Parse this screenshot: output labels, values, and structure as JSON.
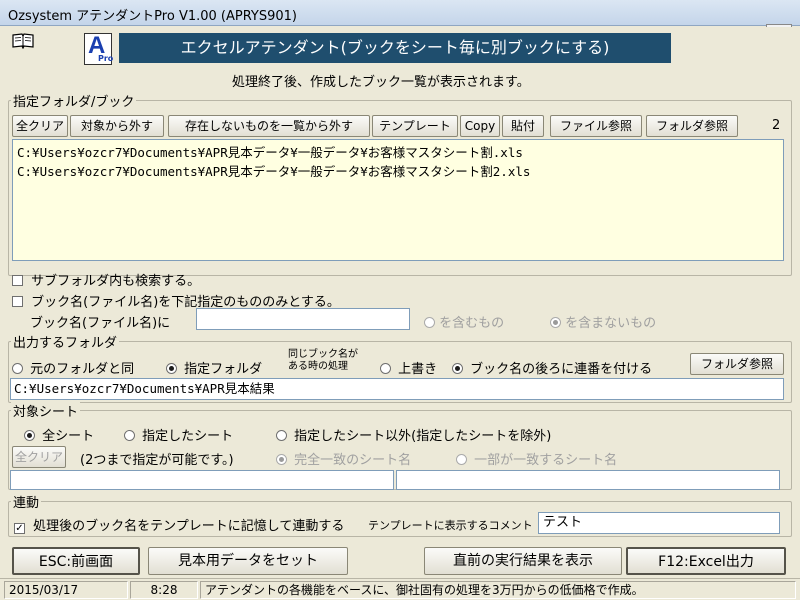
{
  "window": {
    "title": "Ozsystem アテンダントPro V1.00 (APRYS901)",
    "close_glyph": "✕",
    "restore_glyph": "▭"
  },
  "header": {
    "logo_letter": "A",
    "logo_sub": "Pro",
    "banner": "エクセルアテンダント(ブックをシート毎に別ブックにする)",
    "subtitle": "処理終了後、作成したブック一覧が表示されます。"
  },
  "folder_group": {
    "label": "指定フォルダ/ブック",
    "buttons": {
      "clear_all": "全クリア",
      "remove_from_target": "対象から外す",
      "remove_missing": "存在しないものを一覧から外す",
      "template": "テンプレート",
      "copy": "Copy",
      "paste": "貼付",
      "browse_file": "ファイル参照",
      "browse_folder": "フォルダ参照"
    },
    "count": "2",
    "files": [
      "C:¥Users¥ozcr7¥Documents¥APR見本データ¥一般データ¥お客様マスタシート割.xls",
      "C:¥Users¥ozcr7¥Documents¥APR見本データ¥一般データ¥お客様マスタシート割2.xls"
    ],
    "subfolder_label": "サブフォルダ内も検索する。",
    "bookname_only_label": "ブック名(ファイル名)を下記指定のもののみとする。",
    "bookname_field_label": "ブック名(ファイル名)に",
    "bookname_value": "",
    "include_label": "を含むもの",
    "exclude_label": "を含まないもの"
  },
  "output_group": {
    "label": "出力するフォルダ",
    "same_folder_label": "元のフォルダと同",
    "specified_folder_label": "指定フォルダ",
    "same_name_line1": "同じブック名が",
    "same_name_line2": "ある時の処理",
    "overwrite_label": "上書き",
    "append_number_label": "ブック名の後ろに連番を付ける",
    "browse_folder": "フォルダ参照",
    "path": "C:¥Users¥ozcr7¥Documents¥APR見本結果"
  },
  "sheet_group": {
    "label": "対象シート",
    "all_sheets": "全シート",
    "specified_sheets": "指定したシート",
    "except_specified": "指定したシート以外(指定したシートを除外)",
    "clear_all": "全クリア",
    "hint": "(2つまで指定が可能です。)",
    "exact_match": "完全一致のシート名",
    "partial_match": "一部が一致するシート名",
    "field1_value": "",
    "field2_value": ""
  },
  "link_group": {
    "label": "連動",
    "remember_label": "処理後のブック名をテンプレートに記憶して連動する",
    "comment_label": "テンプレートに表示するコメント",
    "comment_value": "テスト"
  },
  "footer_buttons": {
    "esc": "ESC:前画面",
    "sample": "見本用データをセット",
    "prev_result": "直前の実行結果を表示",
    "f12": "F12:Excel出力"
  },
  "status": {
    "date": "2015/03/17",
    "time": "8:28",
    "message": "アテンダントの各機能をベースに、御社固有の処理を3万円からの低価格で作成。"
  },
  "colors": {
    "banner_bg": "#1f4e6e",
    "banner_text": "#ffffff",
    "list_bg": "#ffffe1",
    "logo_blue": "#1a3fb0"
  },
  "states": {
    "subfolder_checked": false,
    "bookname_only_checked": false,
    "include_selected": false,
    "exclude_selected": true,
    "output_same": false,
    "output_specified": true,
    "overwrite": false,
    "append_number": true,
    "sheets_all": true,
    "exact_match": true,
    "remember_checked": true
  }
}
